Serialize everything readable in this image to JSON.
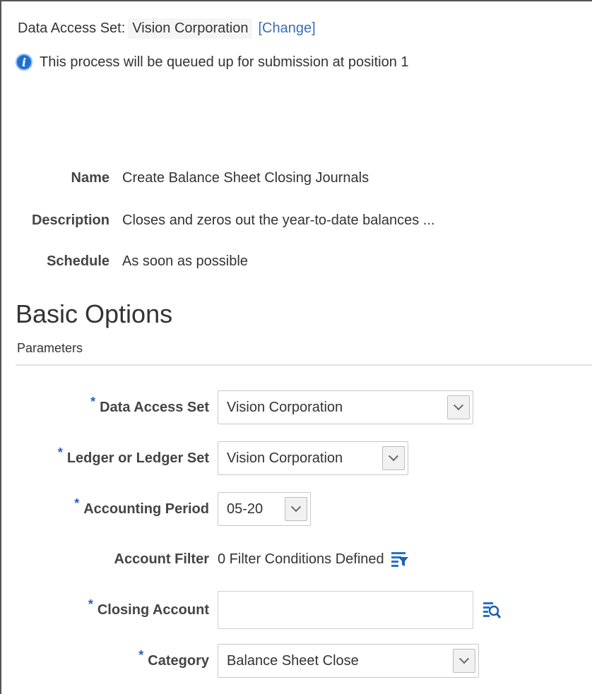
{
  "header": {
    "data_access_set_label": "Data Access Set:",
    "data_access_set_value": "Vision Corporation",
    "change_link": "[Change]",
    "info_message": "This process will be queued up for submission at position 1"
  },
  "process": {
    "name_label": "Name",
    "name_value": "Create Balance Sheet Closing Journals",
    "description_label": "Description",
    "description_value": "Closes and zeros out the year-to-date balances ...",
    "schedule_label": "Schedule",
    "schedule_value": "As soon as possible"
  },
  "section": {
    "title": "Basic Options",
    "subtitle": "Parameters"
  },
  "parameters": {
    "required_marker": "*",
    "data_access_set": {
      "label": "Data Access Set",
      "value": "Vision Corporation"
    },
    "ledger": {
      "label": "Ledger or Ledger Set",
      "value": "Vision Corporation"
    },
    "accounting_period": {
      "label": "Accounting Period",
      "value": "05-20"
    },
    "account_filter": {
      "label": "Account Filter",
      "value": "0 Filter Conditions Defined"
    },
    "closing_account": {
      "label": "Closing Account",
      "value": ""
    },
    "category": {
      "label": "Category",
      "value": "Balance Sheet Close"
    }
  },
  "icons": {
    "info": "info-icon",
    "dropdown": "chevron-down-icon",
    "filter": "filter-icon",
    "search": "search-icon"
  },
  "colors": {
    "link": "#3a6eb5",
    "required": "#2a62b8",
    "info_icon": "#1f6fd1"
  }
}
